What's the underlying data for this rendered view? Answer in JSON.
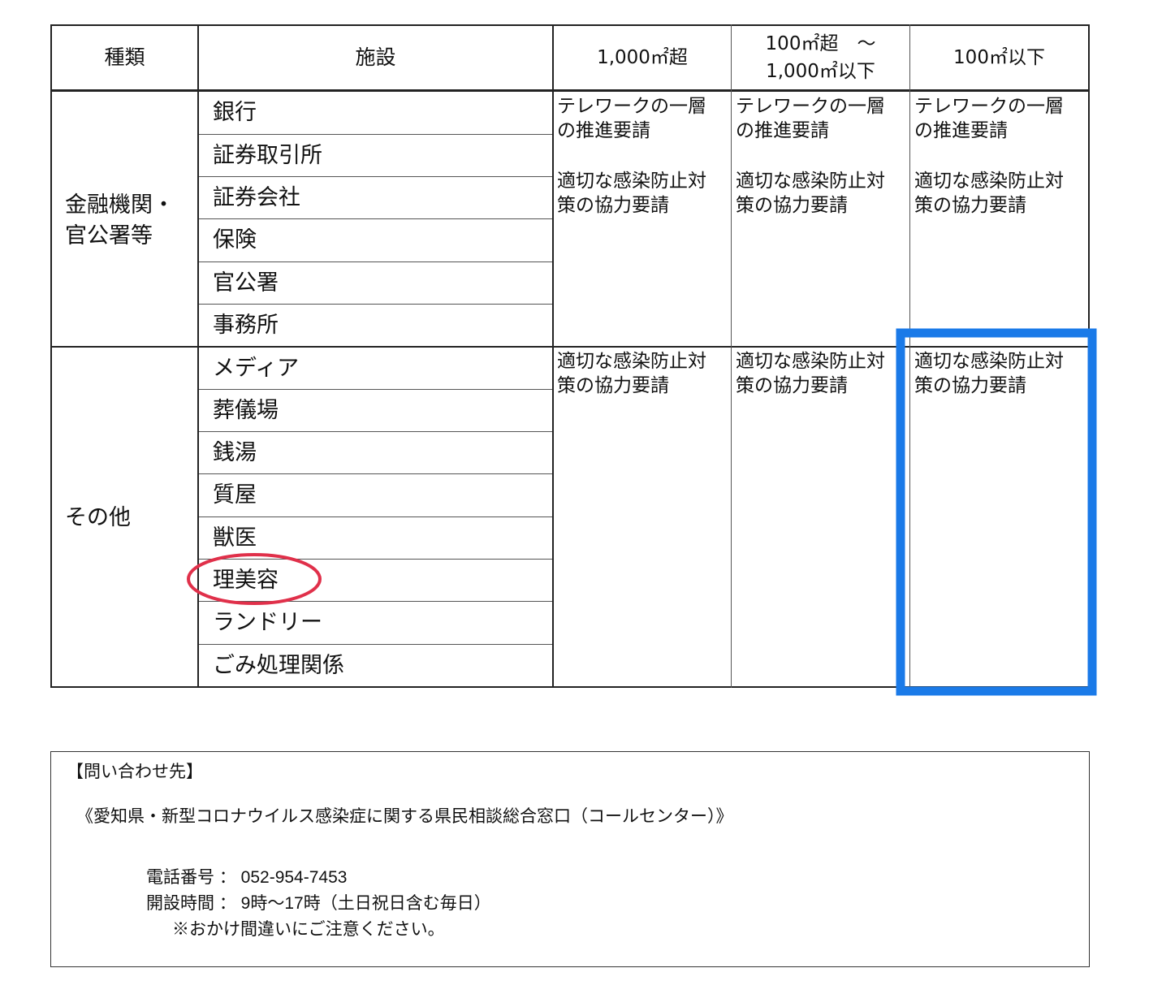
{
  "table": {
    "headers": {
      "type": "種類",
      "facility": "施設",
      "over1000": "1,000㎡超",
      "mid_line1": "100㎡超　～",
      "mid_line2": "1,000㎡以下",
      "under100": "100㎡以下"
    },
    "groups": [
      {
        "category_line1": "金融機関・",
        "category_line2": "官公署等",
        "facilities": [
          "銀行",
          "証券取引所",
          "証券会社",
          "保険",
          "官公署",
          "事務所"
        ],
        "req_line1": "テレワークの一層",
        "req_line2": "の推進要請",
        "req_line3": "適切な感染防止対",
        "req_line4": "策の協力要請"
      },
      {
        "category_line1": "その他",
        "facilities": [
          "メディア",
          "葬儀場",
          "銭湯",
          "質屋",
          "獣医",
          "理美容",
          "ランドリー",
          "ごみ処理関係"
        ],
        "req_line1": "適切な感染防止対",
        "req_line2": "策の協力要請"
      }
    ]
  },
  "contact": {
    "title": "【問い合わせ先】",
    "office": "《愛知県・新型コロナウイルス感染症に関する県民相談総合窓口（コールセンター）》",
    "phone_label": "電話番号",
    "phone_value": "052-954-7453",
    "hours_label": "開設時間",
    "hours_value": "9時～17時（土日祝日含む毎日）",
    "note": "※おかけ間違いにご注意ください。"
  },
  "annotations": {
    "circle_color": "#e0304a",
    "box_color": "#1a7ae8"
  }
}
